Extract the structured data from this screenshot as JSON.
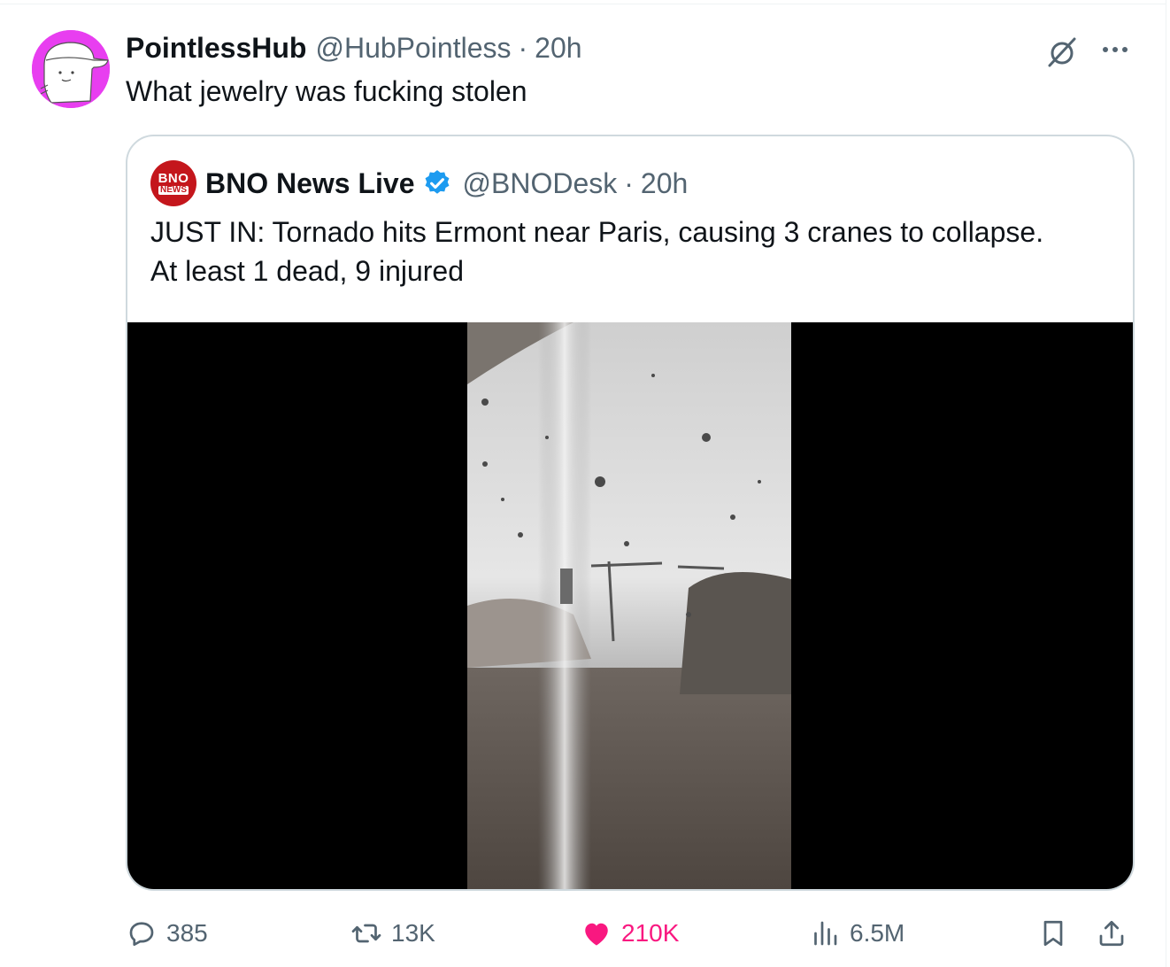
{
  "post": {
    "author_name": "PointlessHub",
    "author_handle": "@HubPointless",
    "separator": "·",
    "time": "20h",
    "text": "What jewelry was fucking stolen",
    "avatar_color": "#e83ef0"
  },
  "quoted_post": {
    "logo_text_top": "BNO",
    "logo_text_bottom": "NEWS",
    "author_name": "BNO News Live",
    "verified": true,
    "author_handle": "@BNODesk",
    "separator": "·",
    "time": "20h",
    "text_line1": "JUST IN: Tornado hits Ermont near Paris, causing 3 cranes to collapse.",
    "text_line2": "At least 1 dead, 9 injured",
    "media": "video-thumbnail-tornado"
  },
  "actions": {
    "replies": "385",
    "reposts": "13K",
    "likes": "210K",
    "views": "6.5M",
    "liked": true
  },
  "icons": [
    "grok-icon",
    "more-icon",
    "verified-badge-icon",
    "reply-icon",
    "repost-icon",
    "like-icon",
    "views-icon",
    "bookmark-icon",
    "share-icon"
  ],
  "colors": {
    "text_primary": "#0f1419",
    "text_secondary": "#536471",
    "like_pink": "#f91880",
    "verified_blue": "#1d9bf0",
    "border": "#cfd9de"
  }
}
